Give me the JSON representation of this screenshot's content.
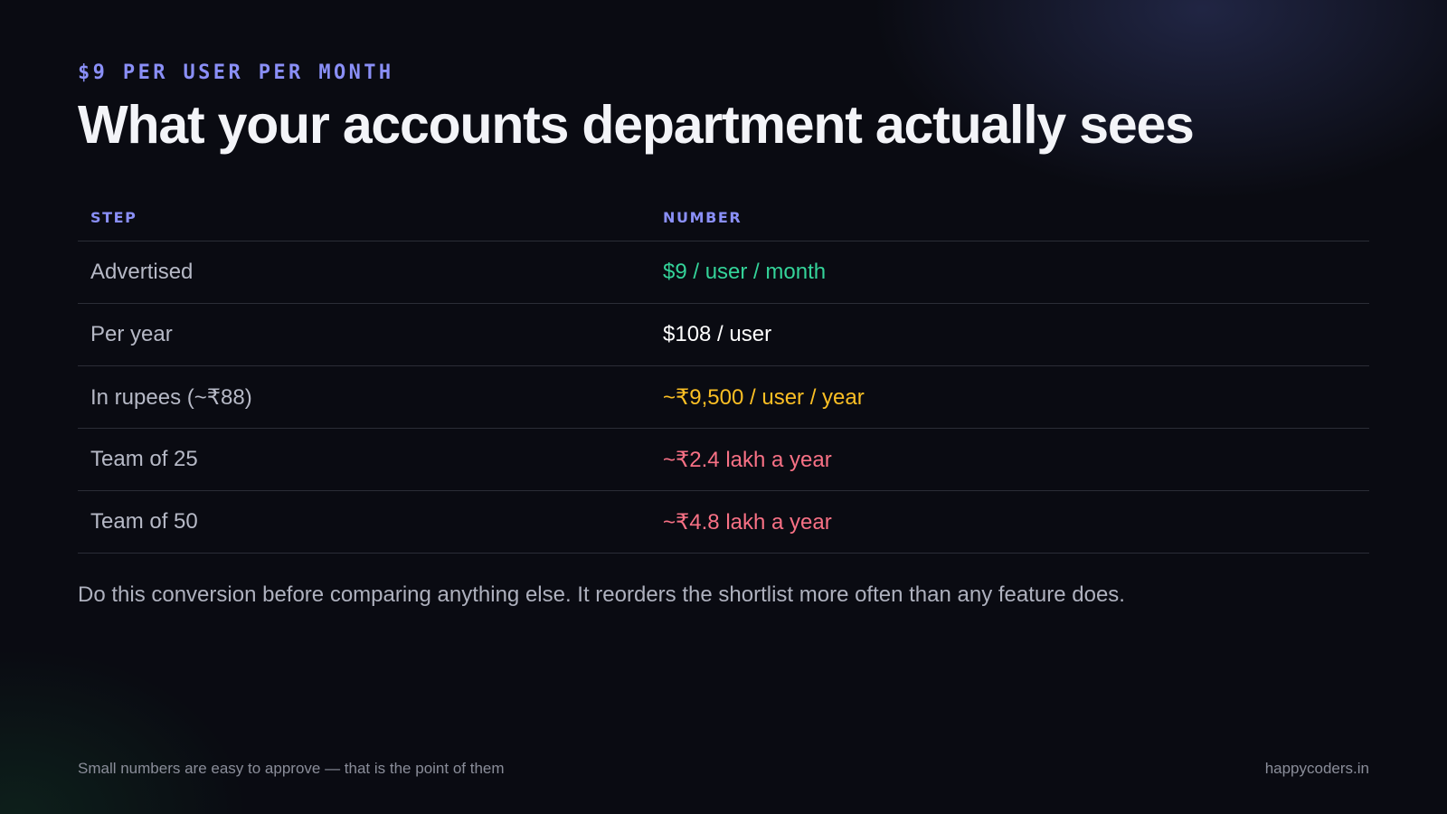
{
  "header": {
    "eyebrow": "$9 PER USER PER MONTH",
    "title": "What your accounts department actually sees"
  },
  "table": {
    "columns": [
      "STEP",
      "NUMBER"
    ],
    "rows": [
      {
        "step": "Advertised",
        "number": "$9 / user / month",
        "color": "#34d399"
      },
      {
        "step": "Per year",
        "number": "$108 / user",
        "color": "#ffffff"
      },
      {
        "step": "In rupees (~₹88)",
        "number": "~₹9,500 / user / year",
        "color": "#fbbf24"
      },
      {
        "step": "Team of 25",
        "number": "~₹2.4 lakh a year",
        "color": "#f87185"
      },
      {
        "step": "Team of 50",
        "number": "~₹4.8 lakh a year",
        "color": "#f87185"
      }
    ]
  },
  "note": "Do this conversion before comparing anything else. It reorders the shortlist more often than any feature does.",
  "footer": {
    "left": "Small numbers are easy to approve — that is the point of them",
    "right": "happycoders.in"
  }
}
